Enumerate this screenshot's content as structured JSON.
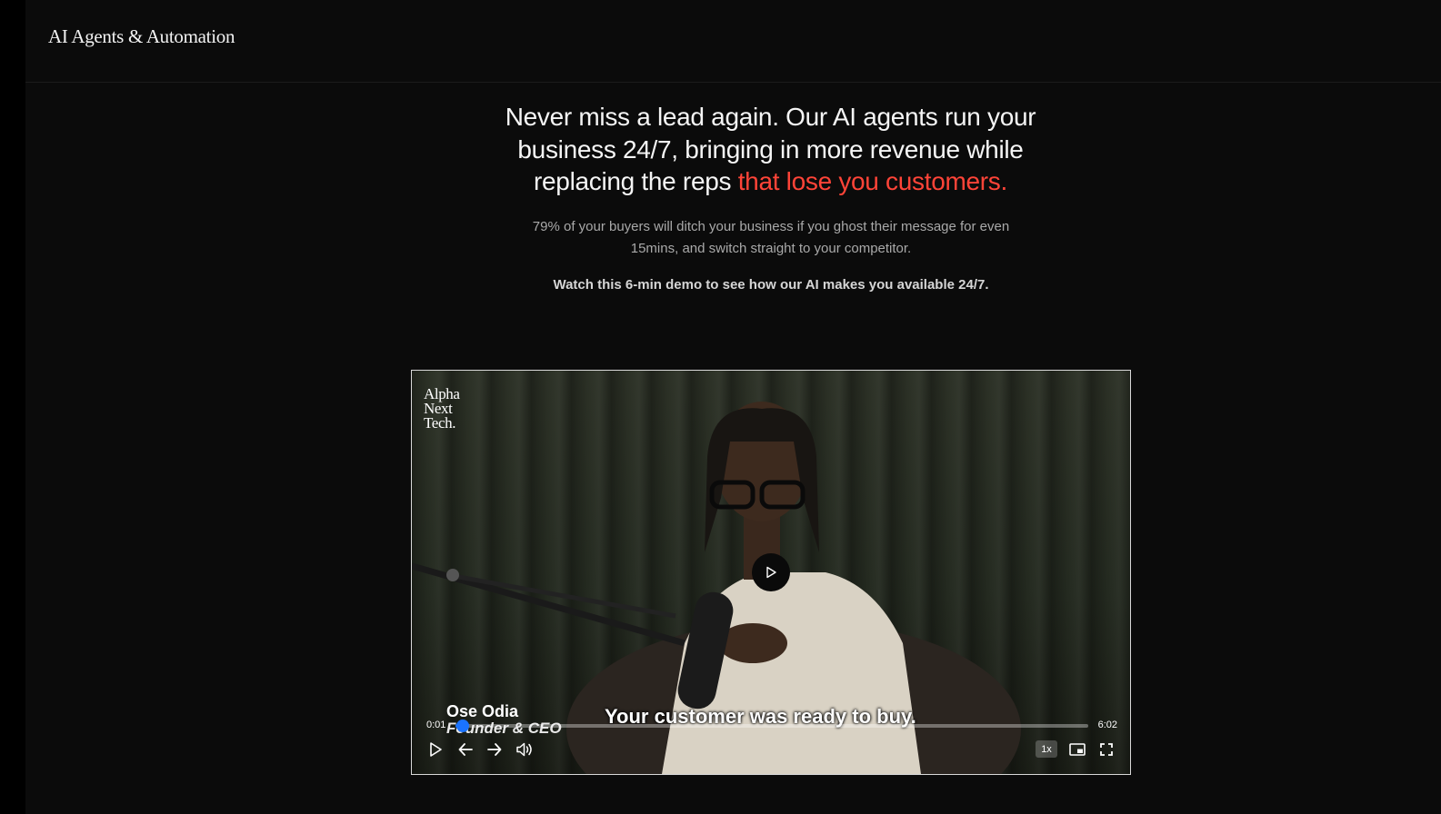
{
  "header": {
    "brand": "AI Agents & Automation"
  },
  "hero": {
    "headline_main": "Never miss a lead again. Our AI agents run your business 24/7, bringing in more revenue while replacing the reps",
    "headline_accent": "that lose you customers.",
    "subtext": "79% of your buyers will ditch your business if you ghost their message for even 15mins, and switch straight to your competitor.",
    "cta": "Watch this 6-min demo to see how our AI makes you available 24/7."
  },
  "video": {
    "logo_line1": "Alpha",
    "logo_line2": "Next",
    "logo_line3": "Tech.",
    "speaker_name": "Ose Odia",
    "speaker_role": "Founder & CEO",
    "caption": "Your customer was ready to buy.",
    "time_current": "0:01",
    "time_total": "6:02",
    "progress_fraction": 0.003,
    "speed": "1x",
    "icons": [
      "play-icon",
      "rewind-icon",
      "forward-icon",
      "volume-icon",
      "picture-in-picture-icon",
      "fullscreen-icon"
    ]
  },
  "colors": {
    "accent_red": "#ff4438",
    "progress_blue": "#1a73ff"
  }
}
